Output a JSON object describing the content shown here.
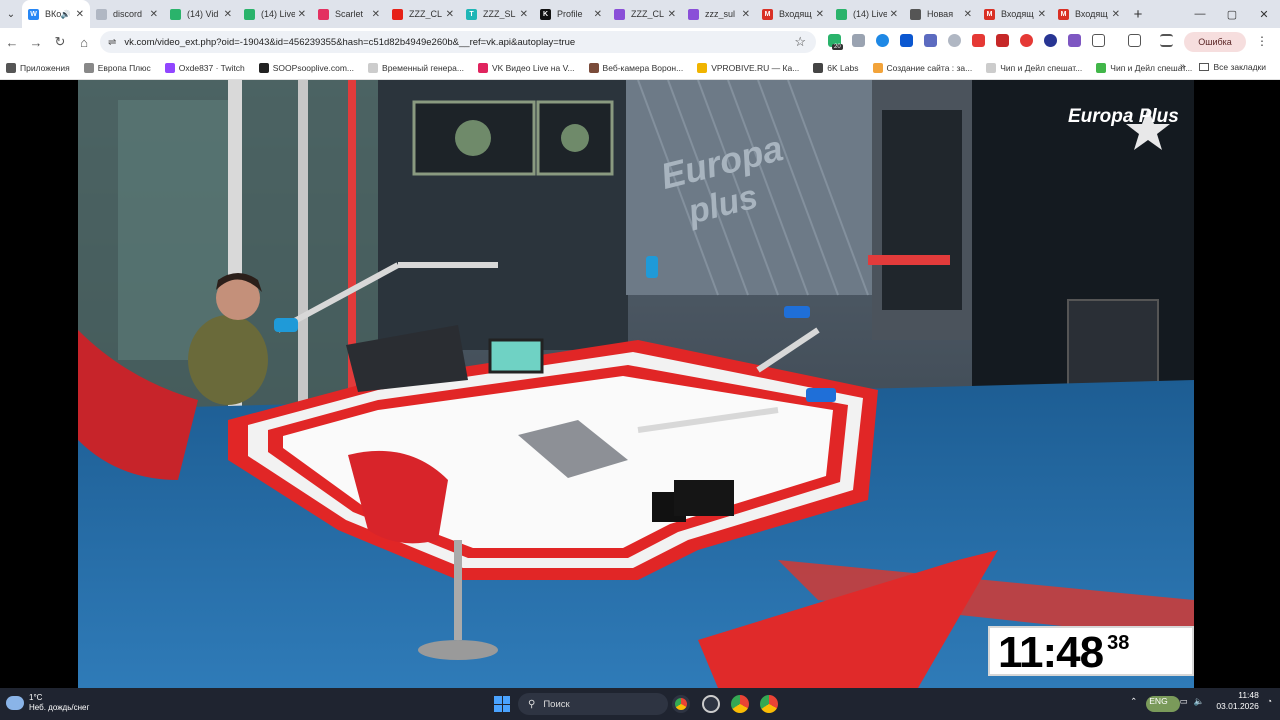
{
  "browser": {
    "tabs": [
      {
        "title": "ВКо",
        "favicon_color": "#2787f5",
        "favicon_letter": "W",
        "active": true,
        "audio": true
      },
      {
        "title": "discord",
        "favicon_color": "#b0b7c3",
        "favicon_letter": "",
        "active": false
      },
      {
        "title": "(14) Vid",
        "favicon_color": "#2ab36b",
        "favicon_letter": "",
        "active": false
      },
      {
        "title": "(14) Live",
        "favicon_color": "#2ab36b",
        "favicon_letter": "",
        "active": false
      },
      {
        "title": "Scarlet",
        "favicon_color": "#e33161",
        "favicon_letter": "",
        "active": false
      },
      {
        "title": "ZZZ_CL",
        "favicon_color": "#e62117",
        "favicon_letter": "",
        "active": false
      },
      {
        "title": "ZZZ_SL",
        "favicon_color": "#1fb6b6",
        "favicon_letter": "T",
        "active": false
      },
      {
        "title": "Profile",
        "favicon_color": "#111111",
        "favicon_letter": "K",
        "active": false
      },
      {
        "title": "ZZZ_CL",
        "favicon_color": "#8a4fd8",
        "favicon_letter": "",
        "active": false
      },
      {
        "title": "zzz_sul",
        "favicon_color": "#8a4fd8",
        "favicon_letter": "",
        "active": false
      },
      {
        "title": "Входящ",
        "favicon_color": "#d93025",
        "favicon_letter": "M",
        "active": false
      },
      {
        "title": "(14) Live",
        "favicon_color": "#2ab36b",
        "favicon_letter": "",
        "active": false
      },
      {
        "title": "Новая",
        "favicon_color": "#555555",
        "favicon_letter": "",
        "active": false
      },
      {
        "title": "Входящ",
        "favicon_color": "#d93025",
        "favicon_letter": "M",
        "active": false
      },
      {
        "title": "Входящ",
        "favicon_color": "#d93025",
        "favicon_letter": "M",
        "active": false
      }
    ],
    "new_tab_label": "+",
    "url": "vk.com/video_ext.php?oid=-19043&id=456239355&hash=c51d82b4949e260b&__ref=vk.api&autoplay=true",
    "error_button_label": "Ошибка",
    "extension_badge": "20",
    "bookmarks": [
      {
        "label": "Приложения",
        "color": "#555555"
      },
      {
        "label": "Европа Плюс",
        "color": "#888888"
      },
      {
        "label": "Oxde837 · Twitch",
        "color": "#9146ff"
      },
      {
        "label": "SOOPsooplive.com...",
        "color": "#222222"
      },
      {
        "label": "Временный генера...",
        "color": "#cccccc"
      },
      {
        "label": "VK Видео Live на V...",
        "color": "#e0245e"
      },
      {
        "label": "Веб-камера Ворон...",
        "color": "#7a4b3a"
      },
      {
        "label": "VPROBIVE.RU — Ка...",
        "color": "#f0b400"
      },
      {
        "label": "6K Labs",
        "color": "#444444"
      },
      {
        "label": "Создание сайта : за...",
        "color": "#f2a33a"
      },
      {
        "label": "Чип и Дейл спешат...",
        "color": "#cccccc"
      },
      {
        "label": "Чип и Дейл спешат...",
        "color": "#41b649"
      }
    ],
    "all_bookmarks_label": "Все закладки"
  },
  "video": {
    "station_logo": "Europa Plus",
    "clock_main": "11:48",
    "clock_seconds": "38"
  },
  "taskbar": {
    "weather_temp": "1°C",
    "weather_desc": "Неб. дождь/снег",
    "search_label": "Поиск",
    "language": "ENG",
    "time": "11:48",
    "date": "03.01.2026"
  }
}
